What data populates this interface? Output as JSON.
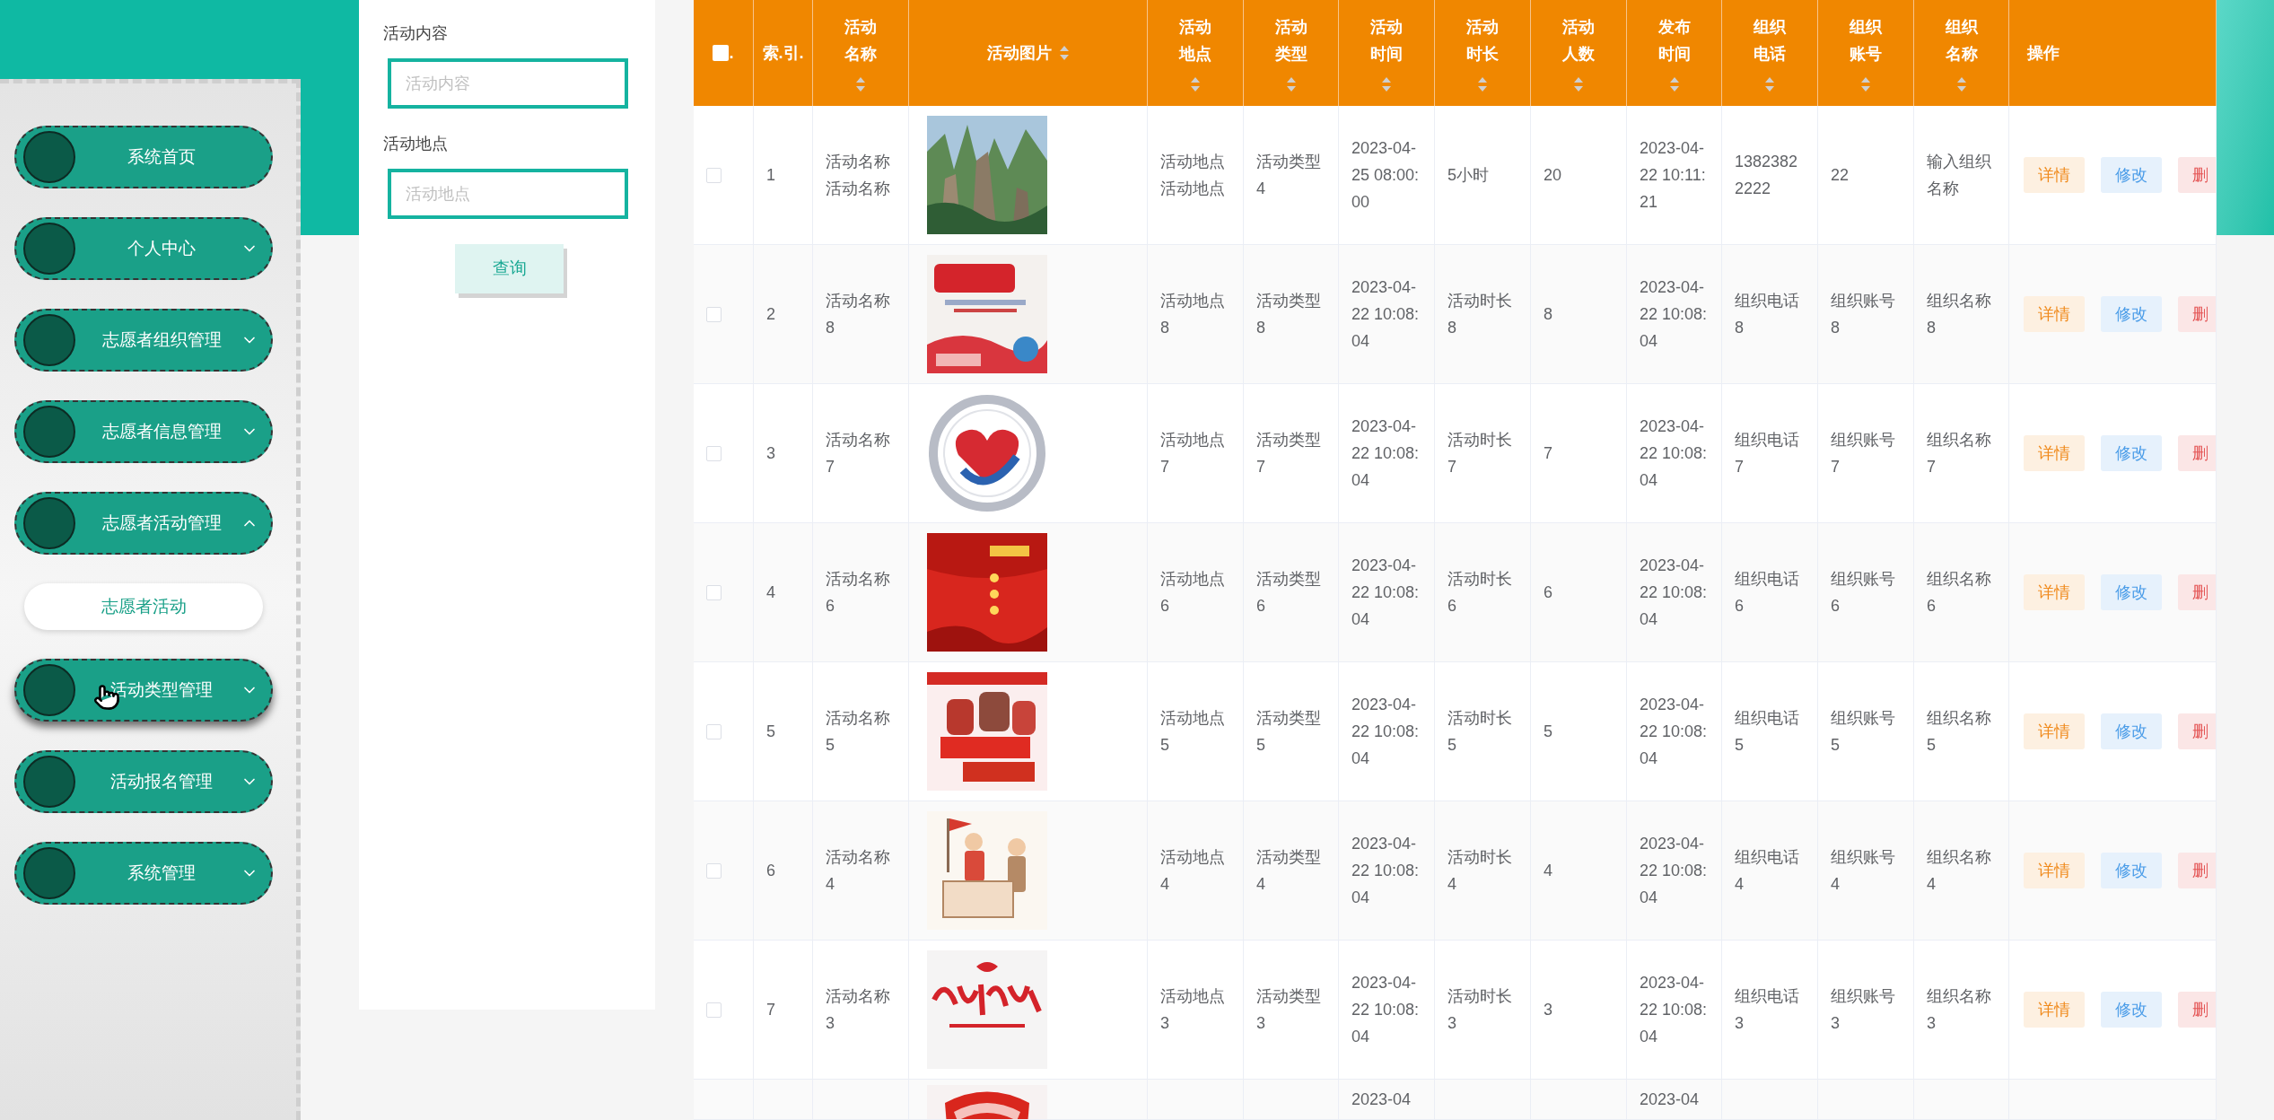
{
  "sidebar": {
    "items": [
      {
        "label": "系统首页",
        "kind": "link",
        "hovered": false
      },
      {
        "label": "个人中心",
        "kind": "group",
        "expanded": false,
        "hovered": false
      },
      {
        "label": "志愿者组织管理",
        "kind": "group",
        "expanded": false,
        "hovered": false
      },
      {
        "label": "志愿者信息管理",
        "kind": "group",
        "expanded": false,
        "hovered": false
      },
      {
        "label": "志愿者活动管理",
        "kind": "group",
        "expanded": true,
        "hovered": false,
        "children": [
          {
            "label": "志愿者活动"
          }
        ]
      },
      {
        "label": "活动类型管理",
        "kind": "group",
        "expanded": false,
        "hovered": true
      },
      {
        "label": "活动报名管理",
        "kind": "group",
        "expanded": false,
        "hovered": false
      },
      {
        "label": "系统管理",
        "kind": "group",
        "expanded": false,
        "hovered": false
      }
    ]
  },
  "search": {
    "fields": [
      {
        "label": "活动内容",
        "placeholder": "活动内容"
      },
      {
        "label": "活动地点",
        "placeholder": "活动地点"
      }
    ],
    "button": "查询"
  },
  "table": {
    "select_all": {
      "label": ".",
      "checked": false
    },
    "columns": [
      {
        "kind": "checkbox"
      },
      {
        "kind": "text",
        "label": "索.引.",
        "sortable": false
      },
      {
        "kind": "text",
        "label": "活动名称",
        "sortable": true
      },
      {
        "kind": "picture",
        "label": "活动图片",
        "sortable": true
      },
      {
        "kind": "text",
        "label": "活动地点",
        "sortable": true
      },
      {
        "kind": "text",
        "label": "活动类型",
        "sortable": true
      },
      {
        "kind": "text",
        "label": "活动时间",
        "sortable": true
      },
      {
        "kind": "text",
        "label": "活动时长",
        "sortable": true
      },
      {
        "kind": "text",
        "label": "活动人数",
        "sortable": true
      },
      {
        "kind": "text",
        "label": "发布时间",
        "sortable": true
      },
      {
        "kind": "text",
        "label": "组织电话",
        "sortable": true
      },
      {
        "kind": "text",
        "label": "组织账号",
        "sortable": true
      },
      {
        "kind": "text",
        "label": "组织名称",
        "sortable": true
      },
      {
        "kind": "actions",
        "label": "操作"
      }
    ],
    "rows": [
      {
        "checked": false,
        "cells": [
          "",
          "1",
          "活动名称活动名称",
          "",
          "活动地点活动地点",
          "活动类型4",
          "2023-04-25 08:00:00",
          "5小时",
          "20",
          "2023-04-22 10:11:21",
          "13823822222",
          "22",
          "输入组织名称"
        ],
        "actions": [
          {
            "kind": "detail",
            "label": "详情"
          },
          {
            "kind": "edit",
            "label": "修改"
          },
          {
            "kind": "delete",
            "label": "删"
          }
        ]
      },
      {
        "checked": false,
        "cells": [
          "",
          "2",
          "活动名称8",
          "",
          "活动地点8",
          "活动类型8",
          "2023-04-22 10:08:04",
          "活动时长8",
          "8",
          "2023-04-22 10:08:04",
          "组织电话8",
          "组织账号8",
          "组织名称8"
        ],
        "actions": [
          {
            "kind": "detail",
            "label": "详情"
          },
          {
            "kind": "edit",
            "label": "修改"
          },
          {
            "kind": "delete",
            "label": "删"
          }
        ]
      },
      {
        "checked": false,
        "cells": [
          "",
          "3",
          "活动名称7",
          "",
          "活动地点7",
          "活动类型7",
          "2023-04-22 10:08:04",
          "活动时长7",
          "7",
          "2023-04-22 10:08:04",
          "组织电话7",
          "组织账号7",
          "组织名称7"
        ],
        "actions": [
          {
            "kind": "detail",
            "label": "详情"
          },
          {
            "kind": "edit",
            "label": "修改"
          },
          {
            "kind": "delete",
            "label": "删"
          }
        ]
      },
      {
        "checked": false,
        "cells": [
          "",
          "4",
          "活动名称6",
          "",
          "活动地点6",
          "活动类型6",
          "2023-04-22 10:08:04",
          "活动时长6",
          "6",
          "2023-04-22 10:08:04",
          "组织电话6",
          "组织账号6",
          "组织名称6"
        ],
        "actions": [
          {
            "kind": "detail",
            "label": "详情"
          },
          {
            "kind": "edit",
            "label": "修改"
          },
          {
            "kind": "delete",
            "label": "删"
          }
        ]
      },
      {
        "checked": false,
        "cells": [
          "",
          "5",
          "活动名称5",
          "",
          "活动地点5",
          "活动类型5",
          "2023-04-22 10:08:04",
          "活动时长5",
          "5",
          "2023-04-22 10:08:04",
          "组织电话5",
          "组织账号5",
          "组织名称5"
        ],
        "actions": [
          {
            "kind": "detail",
            "label": "详情"
          },
          {
            "kind": "edit",
            "label": "修改"
          },
          {
            "kind": "delete",
            "label": "删"
          }
        ]
      },
      {
        "checked": false,
        "cells": [
          "",
          "6",
          "活动名称4",
          "",
          "活动地点4",
          "活动类型4",
          "2023-04-22 10:08:04",
          "活动时长4",
          "4",
          "2023-04-22 10:08:04",
          "组织电话4",
          "组织账号4",
          "组织名称4"
        ],
        "actions": [
          {
            "kind": "detail",
            "label": "详情"
          },
          {
            "kind": "edit",
            "label": "修改"
          },
          {
            "kind": "delete",
            "label": "删"
          }
        ]
      },
      {
        "checked": false,
        "cells": [
          "",
          "7",
          "活动名称3",
          "",
          "活动地点3",
          "活动类型3",
          "2023-04-22 10:08:04",
          "活动时长3",
          "3",
          "2023-04-22 10:08:04",
          "组织电话3",
          "组织账号3",
          "组织名称3"
        ],
        "actions": [
          {
            "kind": "detail",
            "label": "详情"
          },
          {
            "kind": "edit",
            "label": "修改"
          },
          {
            "kind": "delete",
            "label": "删"
          }
        ]
      },
      {
        "cells": [
          "",
          "",
          "",
          "",
          "",
          "",
          "2023-04",
          "",
          "",
          "2023-04",
          "",
          "",
          "",
          ""
        ]
      }
    ]
  }
}
